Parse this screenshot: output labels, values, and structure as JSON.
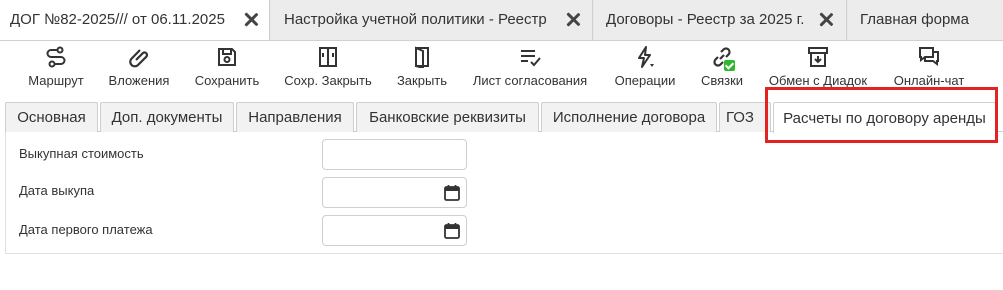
{
  "window_tabs": [
    {
      "label": "ДОГ №82-2025/// от 06.11.2025",
      "active": true
    },
    {
      "label": "Настройка учетной политики - Реестр",
      "active": false
    },
    {
      "label": "Договоры - Реестр за 2025 г.",
      "active": false
    },
    {
      "label": "Главная форма",
      "active": false
    }
  ],
  "toolbar": {
    "route": {
      "label": "Маршрут",
      "icon": "route-icon"
    },
    "attachments": {
      "label": "Вложения",
      "icon": "paperclip-icon"
    },
    "save": {
      "label": "Сохранить",
      "icon": "floppy-icon"
    },
    "save_close": {
      "label": "Сохр. Закрыть",
      "icon": "save-close-icon"
    },
    "close": {
      "label": "Закрыть",
      "icon": "door-icon"
    },
    "approval_sheet": {
      "label": "Лист согласования",
      "icon": "list-check-icon"
    },
    "operations": {
      "label": "Операции",
      "icon": "lightning-icon"
    },
    "links": {
      "label": "Связки",
      "icon": "link-icon"
    },
    "diadoc": {
      "label": "Обмен с Диадок",
      "icon": "archive-icon"
    },
    "online_chat": {
      "label": "Онлайн-чат",
      "icon": "chat-icon"
    }
  },
  "form_tabs": [
    {
      "label": "Основная"
    },
    {
      "label": "Доп. документы"
    },
    {
      "label": "Направления"
    },
    {
      "label": "Банковские реквизиты"
    },
    {
      "label": "Исполнение договора"
    },
    {
      "label": "ГОЗ"
    },
    {
      "label": "Расчеты по договору аренды"
    }
  ],
  "form": {
    "buyout_cost": {
      "label": "Выкупная стоимость",
      "value": ""
    },
    "buyout_date": {
      "label": "Дата выкупа",
      "value": ""
    },
    "first_payment_date": {
      "label": "Дата первого платежа",
      "value": ""
    }
  },
  "colors": {
    "highlight": "#e52222",
    "badge": "#2eb82e"
  }
}
